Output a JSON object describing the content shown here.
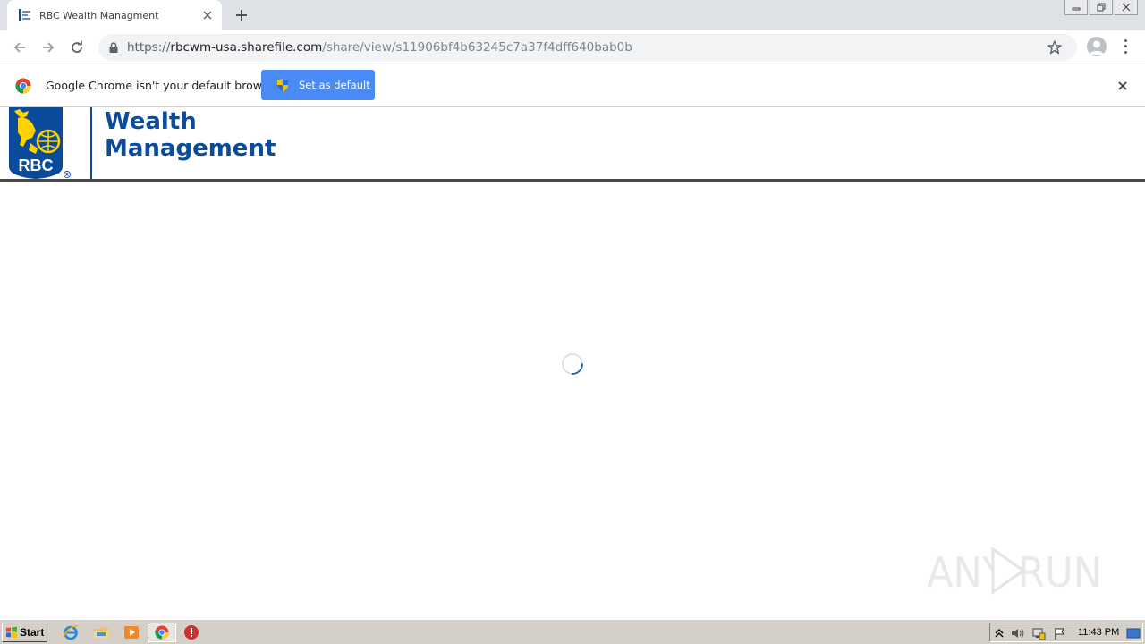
{
  "browser": {
    "tab": {
      "title": "RBC Wealth Managment"
    },
    "address": {
      "scheme": "https://",
      "host": "rbcwm-usa.sharefile.com",
      "path": "/share/view/s11906bf4b63245c7a37f4dff640bab0b"
    },
    "infobar": {
      "message": "Google Chrome isn't your default browser",
      "button_label": "Set as default"
    }
  },
  "page": {
    "brand_line1": "Wealth",
    "brand_line2": "Management",
    "logo_text": "RBC",
    "loading": true
  },
  "watermark": {
    "text": "ANY RUN"
  },
  "taskbar": {
    "start_label": "Start",
    "clock": "11:43 PM"
  },
  "colors": {
    "rbc_blue": "#0a4b9c",
    "rbc_gold": "#ffd200",
    "chrome_button": "#4a8af4",
    "taskbar": "#d4d0c8"
  }
}
